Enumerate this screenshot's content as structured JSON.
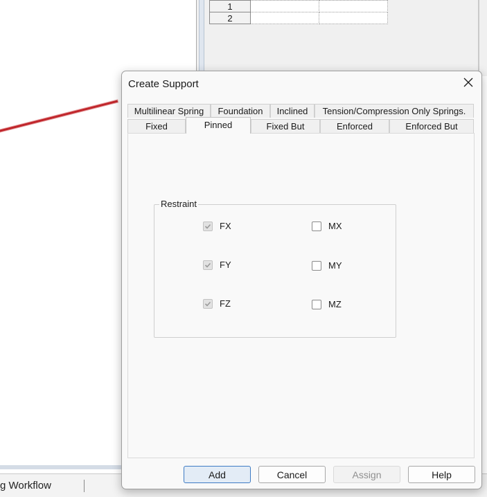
{
  "background": {
    "table_rows": [
      "1",
      "2"
    ],
    "statusbar": {
      "workflow_text": "g Workflow"
    }
  },
  "dialog": {
    "title": "Create Support",
    "close_icon": "close-icon",
    "tabs_row1": [
      "Multilinear Spring",
      "Foundation",
      "Inclined",
      "Tension/Compression Only Springs."
    ],
    "tabs_row2": [
      "Fixed",
      "Pinned",
      "Fixed But",
      "Enforced",
      "Enforced But"
    ],
    "active_tab": "Pinned",
    "restraint": {
      "legend": "Restraint",
      "fx": {
        "label": "FX",
        "checked": true,
        "enabled": false
      },
      "fy": {
        "label": "FY",
        "checked": true,
        "enabled": false
      },
      "fz": {
        "label": "FZ",
        "checked": true,
        "enabled": false
      },
      "mx": {
        "label": "MX",
        "checked": false,
        "enabled": true
      },
      "my": {
        "label": "MY",
        "checked": false,
        "enabled": true
      },
      "mz": {
        "label": "MZ",
        "checked": false,
        "enabled": true
      }
    },
    "buttons": {
      "add": "Add",
      "cancel": "Cancel",
      "assign": "Assign",
      "help": "Help"
    }
  },
  "colors": {
    "member_line": "#c0262b",
    "primary_button_border": "#3d7bc4",
    "dialog_background": "#f9f9f9"
  }
}
